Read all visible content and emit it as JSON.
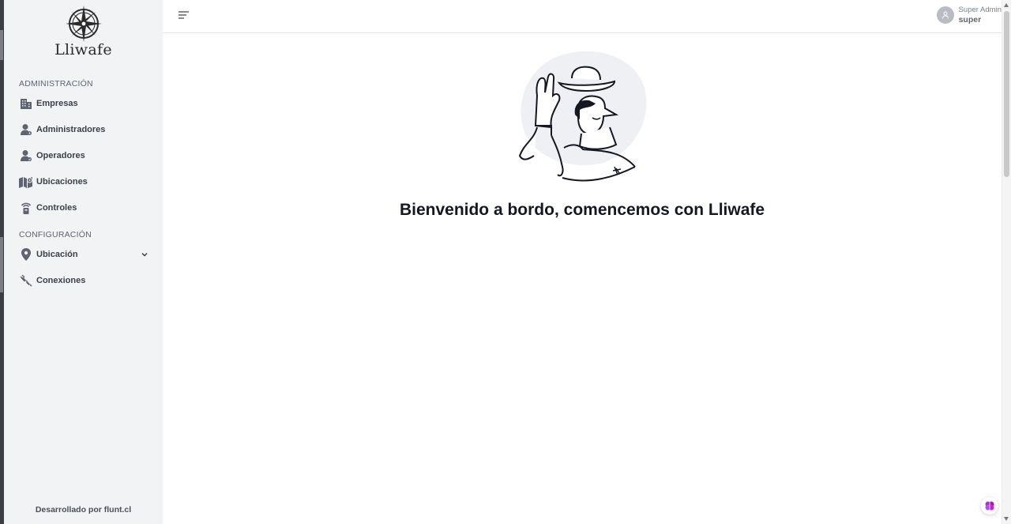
{
  "brand": {
    "name": "Lliwafe"
  },
  "sidebar": {
    "sections": [
      {
        "title": "ADMINISTRACIÓN"
      },
      {
        "title": "CONFIGURACIÓN"
      }
    ],
    "items": [
      {
        "label": "Empresas",
        "icon": "building-icon"
      },
      {
        "label": "Administradores",
        "icon": "user-admin-icon"
      },
      {
        "label": "Operadores",
        "icon": "user-operator-icon"
      },
      {
        "label": "Ubicaciones",
        "icon": "map-icon"
      },
      {
        "label": "Controles",
        "icon": "remote-control-icon"
      },
      {
        "label": "Ubicación",
        "icon": "map-pin-icon"
      },
      {
        "label": "Conexiones",
        "icon": "plug-icon"
      }
    ],
    "footer": "Desarrollado por flunt.cl"
  },
  "header": {
    "user": {
      "role": "Super Admin",
      "name": "super"
    }
  },
  "main": {
    "welcome": "Bienvenido a bordo, comencemos con Lliwafe"
  },
  "colors": {
    "sidebar_bg": "#f2f3f5",
    "text_dark": "#151823",
    "accent": "#c026d3"
  }
}
